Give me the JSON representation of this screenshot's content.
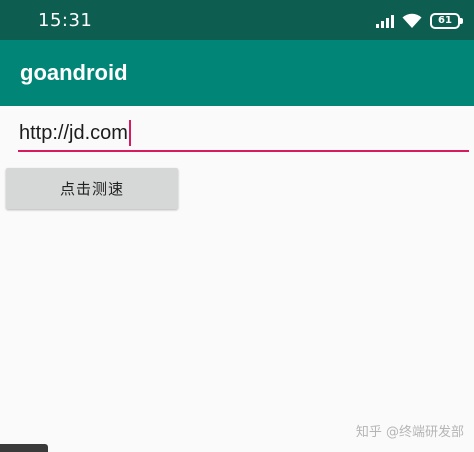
{
  "status_bar": {
    "time": "15:31",
    "battery_level": "61",
    "icons": [
      "signal-icon",
      "wifi-icon",
      "battery-icon"
    ]
  },
  "app_bar": {
    "title": "goandroid"
  },
  "url_input": {
    "value": "http://jd.com"
  },
  "test_button": {
    "label": "点击测速"
  },
  "watermark": {
    "text": "知乎 @终端研发部"
  },
  "colors": {
    "status_bar": "#0d5e50",
    "app_bar": "#008577",
    "accent": "#d81b60",
    "button": "#d6d7d7",
    "background": "#fafafa"
  }
}
